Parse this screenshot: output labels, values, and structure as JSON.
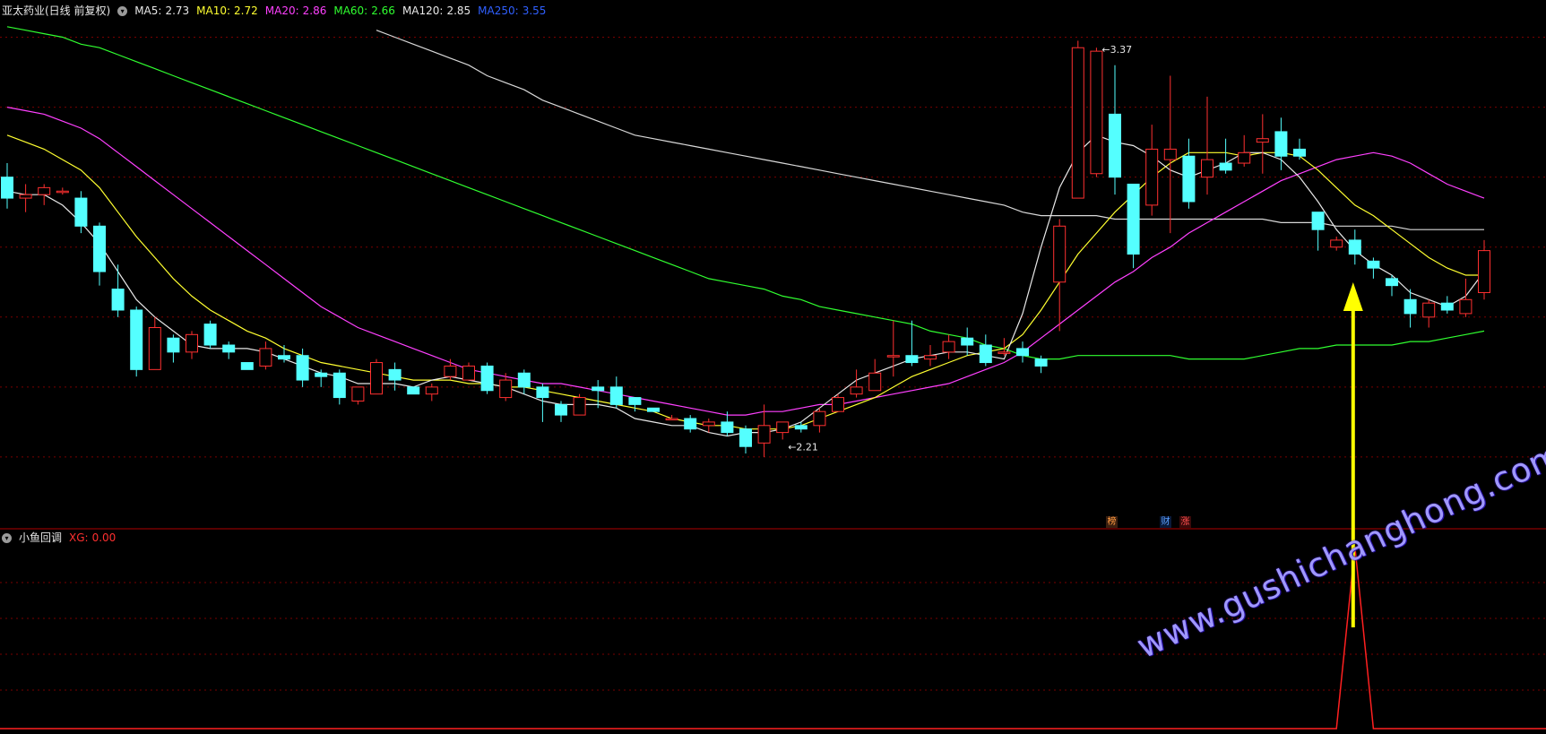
{
  "header": {
    "title": "亚太药业(日线 前复权)",
    "ma": [
      {
        "label": "MA5:",
        "value": "2.73",
        "color": "#e8e8e8",
        "cls": "t-white"
      },
      {
        "label": "MA10:",
        "value": "2.72",
        "color": "#ffff30",
        "cls": "t-yellow"
      },
      {
        "label": "MA20:",
        "value": "2.86",
        "color": "#ff40ff",
        "cls": "t-magenta"
      },
      {
        "label": "MA60:",
        "value": "2.66",
        "color": "#30ff30",
        "cls": "t-green"
      },
      {
        "label": "MA120:",
        "value": "2.85",
        "color": "#e8e8e8",
        "cls": "t-white"
      },
      {
        "label": "MA250:",
        "value": "3.55",
        "color": "#3060ff",
        "cls": "t-blue"
      }
    ]
  },
  "indicator": {
    "name": "小鱼回调",
    "label": "XG:",
    "value": "0.00"
  },
  "badges": [
    "榜",
    "财",
    "涨"
  ],
  "watermark": "www.gushichanghong.com",
  "colors": {
    "up": "#ff3030",
    "down": "#54ffff",
    "grid": "#7a0000",
    "ma5": "#e8e8e8",
    "ma10": "#ffff30",
    "ma20": "#ff40ff",
    "ma60": "#30ff30",
    "ma120": "#d8d8d8",
    "signal": "#ff2020",
    "arrow": "#ffff00"
  },
  "chart_data": {
    "type": "candlestick",
    "price_range": [
      2.0,
      3.45
    ],
    "annotations": [
      {
        "text": "3.37",
        "index": 59
      },
      {
        "text": "2.21",
        "index": 42
      }
    ],
    "candles": [
      [
        3.0,
        2.94,
        3.04,
        2.91
      ],
      [
        2.94,
        2.95,
        2.98,
        2.9
      ],
      [
        2.95,
        2.97,
        2.98,
        2.92
      ],
      [
        2.96,
        2.96,
        2.97,
        2.95
      ],
      [
        2.94,
        2.86,
        2.96,
        2.84
      ],
      [
        2.86,
        2.73,
        2.87,
        2.69
      ],
      [
        2.68,
        2.62,
        2.75,
        2.6
      ],
      [
        2.62,
        2.45,
        2.63,
        2.43
      ],
      [
        2.45,
        2.57,
        2.6,
        2.45
      ],
      [
        2.54,
        2.5,
        2.55,
        2.47
      ],
      [
        2.5,
        2.55,
        2.56,
        2.48
      ],
      [
        2.58,
        2.52,
        2.59,
        2.51
      ],
      [
        2.52,
        2.5,
        2.53,
        2.48
      ],
      [
        2.47,
        2.45,
        2.47,
        2.45
      ],
      [
        2.46,
        2.51,
        2.53,
        2.45
      ],
      [
        2.49,
        2.48,
        2.52,
        2.47
      ],
      [
        2.49,
        2.42,
        2.51,
        2.4
      ],
      [
        2.44,
        2.43,
        2.45,
        2.4
      ],
      [
        2.44,
        2.37,
        2.45,
        2.35
      ],
      [
        2.36,
        2.4,
        2.4,
        2.35
      ],
      [
        2.38,
        2.47,
        2.48,
        2.39
      ],
      [
        2.45,
        2.42,
        2.47,
        2.39
      ],
      [
        2.4,
        2.38,
        2.4,
        2.38
      ],
      [
        2.38,
        2.4,
        2.41,
        2.36
      ],
      [
        2.43,
        2.46,
        2.48,
        2.42
      ],
      [
        2.42,
        2.46,
        2.47,
        2.42
      ],
      [
        2.46,
        2.39,
        2.47,
        2.38
      ],
      [
        2.37,
        2.42,
        2.44,
        2.36
      ],
      [
        2.44,
        2.4,
        2.45,
        2.38
      ],
      [
        2.4,
        2.37,
        2.41,
        2.3
      ],
      [
        2.35,
        2.32,
        2.36,
        2.3
      ],
      [
        2.32,
        2.37,
        2.38,
        2.32
      ],
      [
        2.4,
        2.39,
        2.42,
        2.34
      ],
      [
        2.4,
        2.35,
        2.43,
        2.34
      ],
      [
        2.37,
        2.35,
        2.37,
        2.33
      ],
      [
        2.34,
        2.33,
        2.34,
        2.33
      ],
      [
        2.31,
        2.31,
        2.32,
        2.31
      ],
      [
        2.31,
        2.28,
        2.32,
        2.27
      ],
      [
        2.29,
        2.3,
        2.31,
        2.27
      ],
      [
        2.3,
        2.27,
        2.33,
        2.26
      ],
      [
        2.28,
        2.23,
        2.29,
        2.21
      ],
      [
        2.24,
        2.29,
        2.35,
        2.2
      ],
      [
        2.27,
        2.3,
        2.3,
        2.25
      ],
      [
        2.29,
        2.28,
        2.3,
        2.27
      ],
      [
        2.29,
        2.33,
        2.34,
        2.27
      ],
      [
        2.33,
        2.37,
        2.38,
        2.33
      ],
      [
        2.38,
        2.4,
        2.45,
        2.37
      ],
      [
        2.39,
        2.44,
        2.48,
        2.39
      ],
      [
        2.49,
        2.49,
        2.59,
        2.43
      ],
      [
        2.49,
        2.47,
        2.59,
        2.46
      ],
      [
        2.48,
        2.49,
        2.52,
        2.46
      ],
      [
        2.5,
        2.53,
        2.55,
        2.48
      ],
      [
        2.54,
        2.52,
        2.57,
        2.49
      ],
      [
        2.52,
        2.47,
        2.55,
        2.46
      ],
      [
        2.5,
        2.5,
        2.54,
        2.49
      ],
      [
        2.51,
        2.49,
        2.53,
        2.47
      ],
      [
        2.48,
        2.46,
        2.49,
        2.44
      ],
      [
        2.7,
        2.86,
        2.88,
        2.56
      ],
      [
        2.94,
        3.37,
        3.39,
        3.19
      ],
      [
        3.01,
        3.36,
        3.37,
        3.0
      ],
      [
        3.18,
        3.0,
        3.32,
        2.95
      ],
      [
        2.98,
        2.78,
        2.98,
        2.74
      ],
      [
        2.92,
        3.08,
        3.15,
        2.89
      ],
      [
        3.05,
        3.08,
        3.29,
        2.84
      ],
      [
        3.06,
        2.93,
        3.11,
        2.91
      ],
      [
        3.0,
        3.05,
        3.23,
        2.95
      ],
      [
        3.04,
        3.02,
        3.11,
        3.01
      ],
      [
        3.04,
        3.07,
        3.12,
        3.03
      ],
      [
        3.1,
        3.11,
        3.18,
        3.01
      ],
      [
        3.13,
        3.06,
        3.17,
        3.02
      ],
      [
        3.08,
        3.06,
        3.11,
        3.05
      ],
      [
        2.9,
        2.85,
        2.9,
        2.79
      ],
      [
        2.8,
        2.82,
        2.83,
        2.79
      ],
      [
        2.82,
        2.78,
        2.85,
        2.75
      ],
      [
        2.76,
        2.74,
        2.77,
        2.71
      ],
      [
        2.71,
        2.69,
        2.72,
        2.66
      ],
      [
        2.65,
        2.61,
        2.68,
        2.57
      ],
      [
        2.6,
        2.64,
        2.65,
        2.57
      ],
      [
        2.64,
        2.62,
        2.66,
        2.61
      ],
      [
        2.61,
        2.65,
        2.71,
        2.6
      ],
      [
        2.67,
        2.79,
        2.82,
        2.65
      ]
    ],
    "ma5": [
      2.96,
      2.95,
      2.95,
      2.92,
      2.87,
      2.81,
      2.73,
      2.65,
      2.6,
      2.56,
      2.52,
      2.51,
      2.51,
      2.51,
      2.5,
      2.48,
      2.46,
      2.44,
      2.43,
      2.41,
      2.41,
      2.41,
      2.4,
      2.42,
      2.43,
      2.42,
      2.41,
      2.4,
      2.38,
      2.36,
      2.35,
      2.35,
      2.35,
      2.34,
      2.31,
      2.3,
      2.29,
      2.29,
      2.27,
      2.26,
      2.27,
      2.27,
      2.28,
      2.3,
      2.34,
      2.38,
      2.42,
      2.44,
      2.46,
      2.48,
      2.49,
      2.5,
      2.5,
      2.49,
      2.48,
      2.61,
      2.8,
      2.97,
      3.07,
      3.12,
      3.1,
      3.09,
      3.06,
      3.02,
      3.0,
      3.02,
      3.04,
      3.07,
      3.07,
      3.05,
      3.0,
      2.93,
      2.85,
      2.79,
      2.75,
      2.72,
      2.67,
      2.65,
      2.63,
      2.66,
      2.73
    ],
    "ma10": [
      3.12,
      3.1,
      3.08,
      3.05,
      3.02,
      2.97,
      2.9,
      2.83,
      2.77,
      2.71,
      2.66,
      2.62,
      2.59,
      2.56,
      2.54,
      2.51,
      2.49,
      2.47,
      2.46,
      2.45,
      2.44,
      2.43,
      2.42,
      2.42,
      2.42,
      2.41,
      2.41,
      2.4,
      2.4,
      2.39,
      2.38,
      2.37,
      2.36,
      2.35,
      2.34,
      2.33,
      2.31,
      2.3,
      2.29,
      2.29,
      2.28,
      2.28,
      2.28,
      2.29,
      2.31,
      2.33,
      2.35,
      2.37,
      2.4,
      2.43,
      2.45,
      2.47,
      2.49,
      2.5,
      2.51,
      2.55,
      2.62,
      2.7,
      2.78,
      2.84,
      2.9,
      2.95,
      3.0,
      3.04,
      3.07,
      3.07,
      3.07,
      3.06,
      3.07,
      3.07,
      3.06,
      3.02,
      2.97,
      2.92,
      2.89,
      2.85,
      2.81,
      2.77,
      2.74,
      2.72,
      2.72
    ],
    "ma20": [
      3.2,
      3.19,
      3.18,
      3.16,
      3.14,
      3.11,
      3.07,
      3.03,
      2.99,
      2.95,
      2.91,
      2.87,
      2.83,
      2.79,
      2.75,
      2.71,
      2.67,
      2.63,
      2.6,
      2.57,
      2.55,
      2.53,
      2.51,
      2.49,
      2.47,
      2.45,
      2.44,
      2.43,
      2.42,
      2.41,
      2.41,
      2.4,
      2.39,
      2.38,
      2.37,
      2.36,
      2.35,
      2.34,
      2.33,
      2.32,
      2.32,
      2.33,
      2.33,
      2.34,
      2.35,
      2.35,
      2.36,
      2.37,
      2.38,
      2.39,
      2.4,
      2.41,
      2.43,
      2.45,
      2.47,
      2.5,
      2.54,
      2.58,
      2.62,
      2.66,
      2.7,
      2.73,
      2.77,
      2.8,
      2.84,
      2.87,
      2.9,
      2.93,
      2.96,
      2.99,
      3.01,
      3.03,
      3.05,
      3.06,
      3.07,
      3.06,
      3.04,
      3.01,
      2.98,
      2.96,
      2.94
    ],
    "ma60": [
      3.43,
      3.42,
      3.41,
      3.4,
      3.38,
      3.37,
      3.35,
      3.33,
      3.31,
      3.29,
      3.27,
      3.25,
      3.23,
      3.21,
      3.19,
      3.17,
      3.15,
      3.13,
      3.11,
      3.09,
      3.07,
      3.05,
      3.03,
      3.01,
      2.99,
      2.97,
      2.95,
      2.93,
      2.91,
      2.89,
      2.87,
      2.85,
      2.83,
      2.81,
      2.79,
      2.77,
      2.75,
      2.73,
      2.71,
      2.7,
      2.69,
      2.68,
      2.66,
      2.65,
      2.63,
      2.62,
      2.61,
      2.6,
      2.59,
      2.58,
      2.56,
      2.55,
      2.54,
      2.52,
      2.51,
      2.49,
      2.48,
      2.48,
      2.49,
      2.49,
      2.49,
      2.49,
      2.49,
      2.49,
      2.48,
      2.48,
      2.48,
      2.48,
      2.49,
      2.5,
      2.51,
      2.51,
      2.52,
      2.52,
      2.52,
      2.52,
      2.53,
      2.53,
      2.54,
      2.55,
      2.56
    ],
    "ma120": [
      null,
      null,
      null,
      null,
      null,
      null,
      null,
      null,
      null,
      null,
      null,
      null,
      null,
      null,
      null,
      null,
      null,
      null,
      null,
      null,
      3.42,
      3.4,
      3.38,
      3.36,
      3.34,
      3.32,
      3.29,
      3.27,
      3.25,
      3.22,
      3.2,
      3.18,
      3.16,
      3.14,
      3.12,
      3.11,
      3.1,
      3.09,
      3.08,
      3.07,
      3.06,
      3.05,
      3.04,
      3.03,
      3.02,
      3.01,
      3.0,
      2.99,
      2.98,
      2.97,
      2.96,
      2.95,
      2.94,
      2.93,
      2.92,
      2.9,
      2.89,
      2.89,
      2.89,
      2.89,
      2.88,
      2.88,
      2.88,
      2.88,
      2.88,
      2.88,
      2.88,
      2.88,
      2.88,
      2.87,
      2.87,
      2.87,
      2.86,
      2.86,
      2.86,
      2.86,
      2.85,
      2.85,
      2.85,
      2.85,
      2.85
    ],
    "xg_signal_index": 73
  }
}
